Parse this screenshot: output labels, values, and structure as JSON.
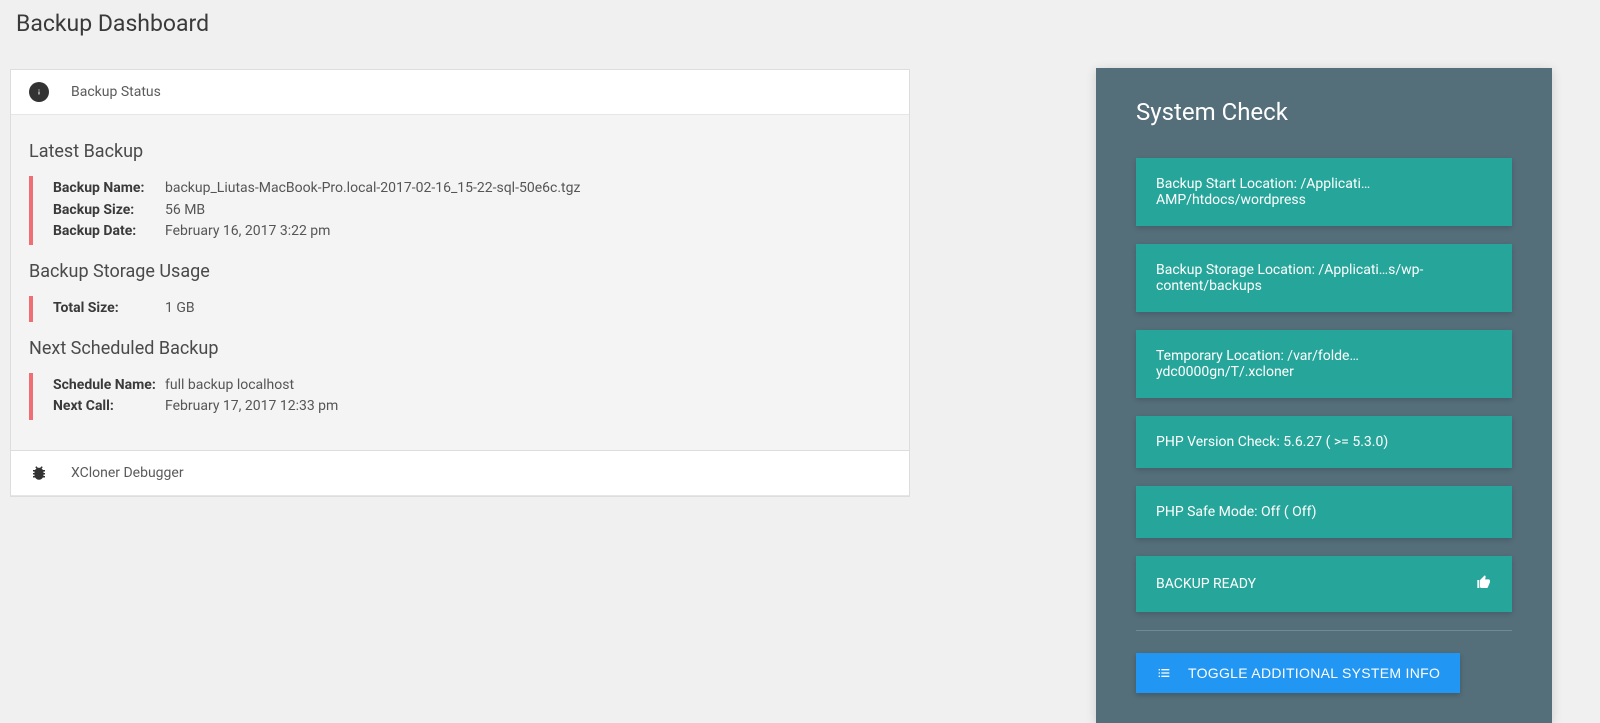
{
  "page_title": "Backup Dashboard",
  "status_card": {
    "header": "Backup Status",
    "latest_title": "Latest Backup",
    "latest": {
      "name_label": "Backup Name:",
      "name_value": "backup_Liutas-MacBook-Pro.local-2017-02-16_15-22-sql-50e6c.tgz",
      "size_label": "Backup Size:",
      "size_value": "56 MB",
      "date_label": "Backup Date:",
      "date_value": "February 16, 2017 3:22 pm"
    },
    "storage_title": "Backup Storage Usage",
    "storage": {
      "total_label": "Total Size:",
      "total_value": "1 GB"
    },
    "next_title": "Next Scheduled Backup",
    "next": {
      "schedule_label": "Schedule Name:",
      "schedule_value": "full backup localhost",
      "call_label": "Next Call:",
      "call_value": "February 17, 2017 12:33 pm"
    }
  },
  "debugger_card": {
    "header": "XCloner Debugger"
  },
  "system_check": {
    "title": "System Check",
    "items": [
      "Backup Start Location: /Applicati…AMP/htdocs/wordpress",
      "Backup Storage Location: /Applicati…s/wp-content/backups",
      "Temporary Location: /var/folde…ydc0000gn/T/.xcloner",
      "PHP Version Check: 5.6.27 ( >= 5.3.0)",
      "PHP Safe Mode: Off ( Off)"
    ],
    "ready": "BACKUP READY",
    "toggle_btn": "TOGGLE ADDITIONAL SYSTEM INFO"
  }
}
